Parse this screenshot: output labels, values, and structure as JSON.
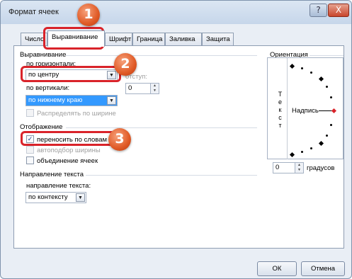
{
  "window": {
    "title": "Формат ячеек",
    "help_label": "?",
    "close_label": "X"
  },
  "tabs": [
    "Число",
    "Выравнивание",
    "Шрифт",
    "Граница",
    "Заливка",
    "Защита"
  ],
  "alignment": {
    "group_label": "Выравнивание",
    "horizontal_label": "по горизонтали:",
    "horizontal_value": "по центру",
    "indent_label": "отступ:",
    "indent_value": "0",
    "vertical_label": "по вертикали:",
    "vertical_value": "по нижнему краю",
    "distribute_label": "Распределять по ширине"
  },
  "display": {
    "group_label": "Отображение",
    "wrap_label": "переносить по словам",
    "wrap_checked": true,
    "autofit_label": "автоподбор ширины",
    "merge_label": "объединение ячеек"
  },
  "direction": {
    "group_label": "Направление текста",
    "direction_label": "направление текста:",
    "direction_value": "по контексту"
  },
  "orientation": {
    "group_label": "Ориентация",
    "vertical_text": [
      "Т",
      "е",
      "к",
      "с",
      "т"
    ],
    "caption": "Надпись",
    "degrees_value": "0",
    "degrees_label": "градусов"
  },
  "buttons": {
    "ok": "ОК",
    "cancel": "Отмена"
  },
  "markers": [
    "1",
    "2",
    "3"
  ],
  "colors": {
    "highlight": "#d9232a",
    "badge": "#e05a26",
    "selection": "#3399ff"
  }
}
